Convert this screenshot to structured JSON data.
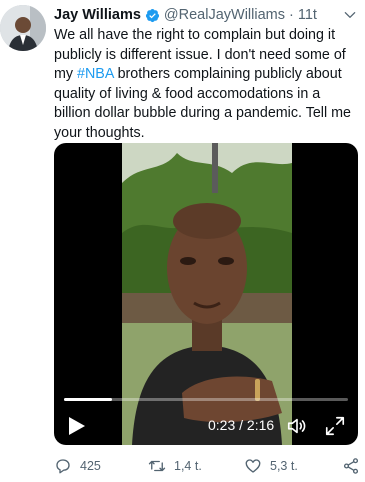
{
  "tweet": {
    "author_name": "Jay Williams",
    "handle": "@RealJayWilliams",
    "separator": "·",
    "time": "11t",
    "text_before": "We all have the right to complain but doing it publicly is different issue. I don't need some of my ",
    "hashtag": "#NBA",
    "text_after": " brothers complaining publicly about quality of living & food accomodations in a billion dollar bubble during a pandemic. Tell me your thoughts."
  },
  "video": {
    "time_readout": "0:23 / 2:16",
    "progress_fraction": 0.17
  },
  "actions": {
    "reply_count": "425",
    "retweet_count": "1,4 t.",
    "like_count": "5,3 t."
  },
  "icons": {
    "verified": "verified-badge-icon",
    "caret": "chevron-down-icon",
    "play": "play-icon",
    "volume": "volume-icon",
    "fullscreen": "fullscreen-icon",
    "reply": "reply-icon",
    "retweet": "retweet-icon",
    "like": "heart-icon",
    "share": "share-icon"
  },
  "colors": {
    "accent": "#1d9bf0",
    "muted": "#536471",
    "text": "#0f1419"
  }
}
